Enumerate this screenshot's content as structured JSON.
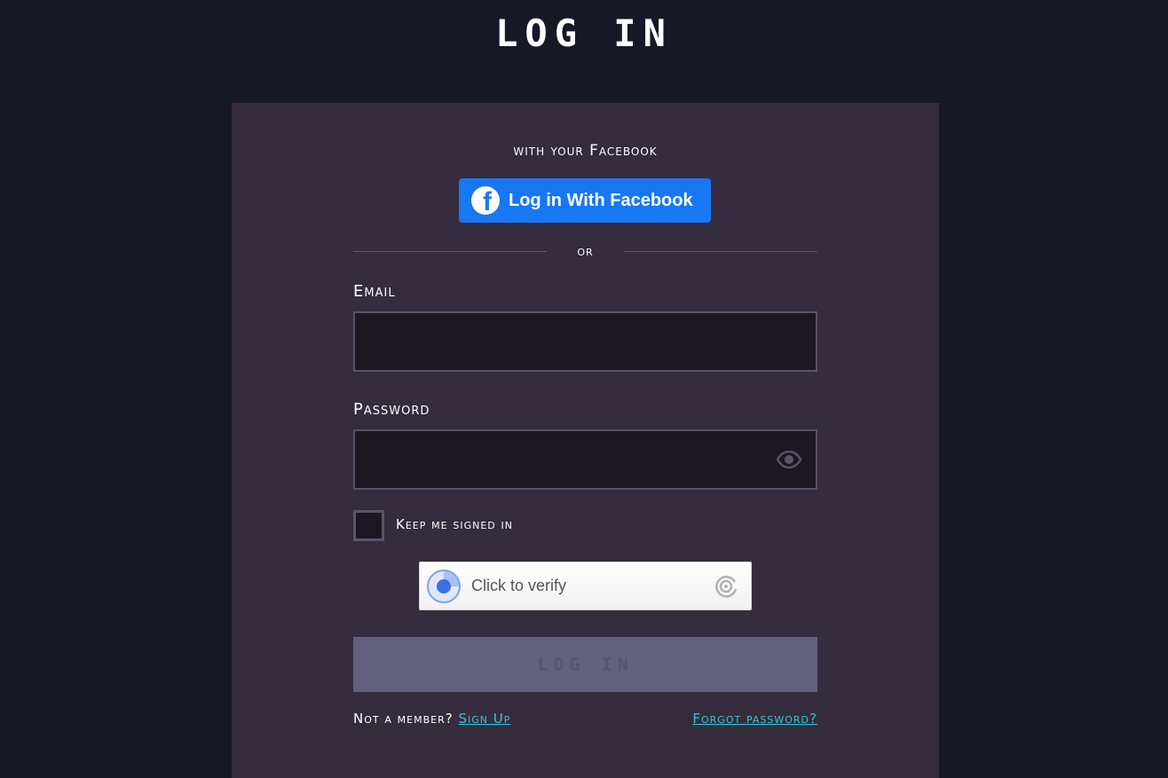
{
  "page": {
    "title": "LOG IN"
  },
  "facebook": {
    "caption": "with your Facebook",
    "button_label": "Log in With Facebook",
    "icon": "facebook-icon",
    "color": "#1877f2"
  },
  "divider": {
    "label": "or"
  },
  "email": {
    "label": "Email",
    "value": "",
    "placeholder": ""
  },
  "password": {
    "label": "Password",
    "value": "",
    "placeholder": "",
    "toggle_icon": "eye-icon"
  },
  "remember": {
    "label": "Keep me signed in",
    "checked": false
  },
  "captcha": {
    "label": "Click to verify",
    "icon": "captcha-spinner-icon",
    "logo": "captcha-logo-icon"
  },
  "submit": {
    "label": "LOG IN",
    "disabled": true
  },
  "footer": {
    "not_member_text": "Not a member?",
    "signup_link": "Sign Up",
    "forgot_link": "Forgot password?"
  },
  "colors": {
    "background": "#171827",
    "card": "#352c3e",
    "input_bg": "#1b1822",
    "submit_disabled": "#62607c",
    "link": "#34c6d8"
  }
}
